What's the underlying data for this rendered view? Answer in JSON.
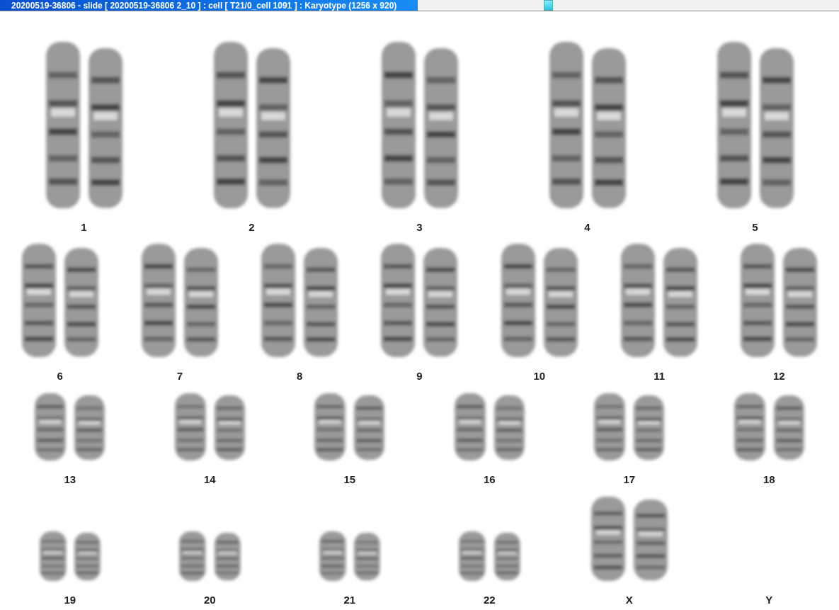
{
  "window": {
    "title": "20200519-36806 - slide [ 20200519-36806 2_10 ] : cell [ T21/0_cell 1091 ] : Karyotype  (1256 x 920)"
  },
  "rows": [
    {
      "items": [
        {
          "label": "1",
          "kind": "pair"
        },
        {
          "label": "2",
          "kind": "pair"
        },
        {
          "label": "3",
          "kind": "pair"
        },
        {
          "label": "4",
          "kind": "pair"
        },
        {
          "label": "5",
          "kind": "pair"
        }
      ]
    },
    {
      "items": [
        {
          "label": "6",
          "kind": "pair"
        },
        {
          "label": "7",
          "kind": "pair"
        },
        {
          "label": "8",
          "kind": "pair"
        },
        {
          "label": "9",
          "kind": "pair"
        },
        {
          "label": "10",
          "kind": "pair"
        },
        {
          "label": "11",
          "kind": "pair"
        },
        {
          "label": "12",
          "kind": "pair"
        }
      ]
    },
    {
      "items": [
        {
          "label": "13",
          "kind": "pair"
        },
        {
          "label": "14",
          "kind": "pair"
        },
        {
          "label": "15",
          "kind": "pair"
        },
        {
          "label": "16",
          "kind": "pair"
        },
        {
          "label": "17",
          "kind": "pair"
        },
        {
          "label": "18",
          "kind": "pair"
        }
      ]
    },
    {
      "items": [
        {
          "label": "19",
          "kind": "pair"
        },
        {
          "label": "20",
          "kind": "pair"
        },
        {
          "label": "21",
          "kind": "pair"
        },
        {
          "label": "22",
          "kind": "pair"
        },
        {
          "label": "X",
          "kind": "tall-pair"
        },
        {
          "label": "Y",
          "kind": "empty"
        }
      ]
    }
  ]
}
